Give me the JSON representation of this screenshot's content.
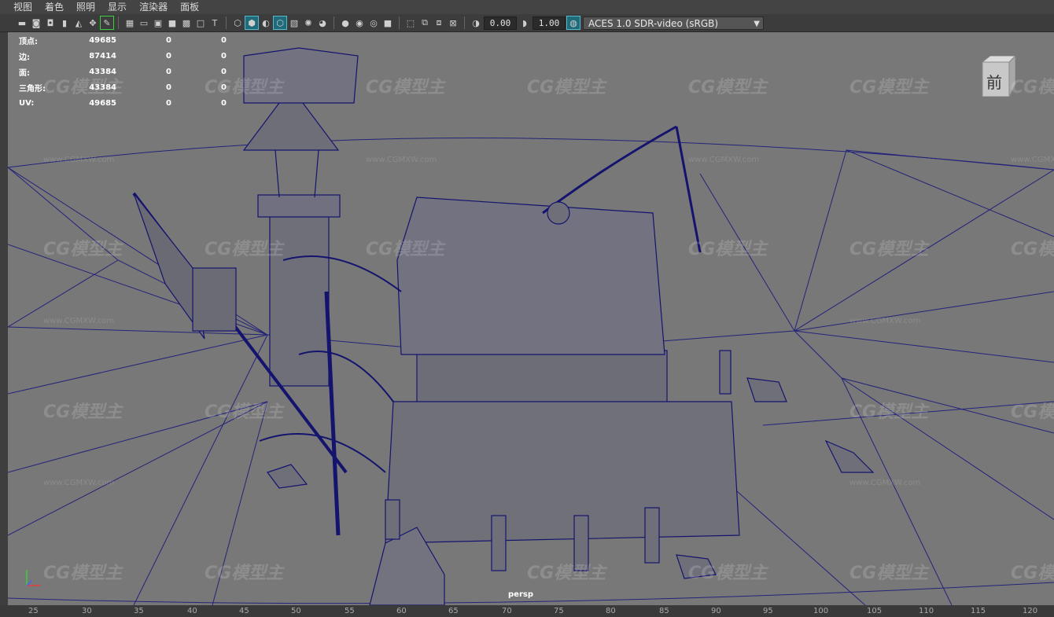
{
  "menu": [
    "视图",
    "着色",
    "照明",
    "显示",
    "渲染器",
    "面板"
  ],
  "toolbar": {
    "icons": [
      "camera-select-icon",
      "camera-attr-icon",
      "bookmark-icon",
      "image-plane-icon",
      "2d-pan-icon",
      "grease-pencil-icon",
      "grid-icon",
      "film-gate-icon",
      "resolution-gate-icon",
      "gate-mask-icon",
      "field-chart-icon",
      "safe-action-icon",
      "safe-title-icon",
      "wireframe-icon",
      "smooth-shade-icon",
      "default-material-icon",
      "wireframe-on-shaded-icon",
      "xray-icon",
      "use-lights-icon",
      "shadows-icon",
      "ambient-occlusion-icon",
      "motion-blur-icon",
      "antialias-icon",
      "depth-of-field-icon",
      "isolate-select-icon",
      "xray-joints-icon",
      "xray-active-icon",
      "backface-icon",
      "exposure-icon",
      "gamma-icon",
      "color-management-icon"
    ],
    "exposure_value": "0.00",
    "gamma_value": "1.00",
    "color_space": "ACES 1.0 SDR-video (sRGB)"
  },
  "hud": {
    "rows": [
      {
        "label": "顶点:",
        "value": "49685",
        "sel": "0",
        "comp": "0"
      },
      {
        "label": "边:",
        "value": "87414",
        "sel": "0",
        "comp": "0"
      },
      {
        "label": "面:",
        "value": "43384",
        "sel": "0",
        "comp": "0"
      },
      {
        "label": "三角形:",
        "value": "43384",
        "sel": "0",
        "comp": "0"
      },
      {
        "label": "UV:",
        "value": "49685",
        "sel": "0",
        "comp": "0"
      }
    ]
  },
  "viewcube_label": "前",
  "camera_label": "persp",
  "watermark": {
    "text": "CG模型主",
    "url": "www.CGMXW.com"
  },
  "ruler_ticks": [
    "25",
    "30",
    "35",
    "40",
    "45",
    "50",
    "55",
    "60",
    "65",
    "70",
    "75",
    "80",
    "85",
    "90",
    "95",
    "100",
    "105",
    "110",
    "115",
    "120"
  ],
  "colors": {
    "wire": "#1a1a7a",
    "viewport_bg": "#787878",
    "accent": "#58b9cc"
  }
}
